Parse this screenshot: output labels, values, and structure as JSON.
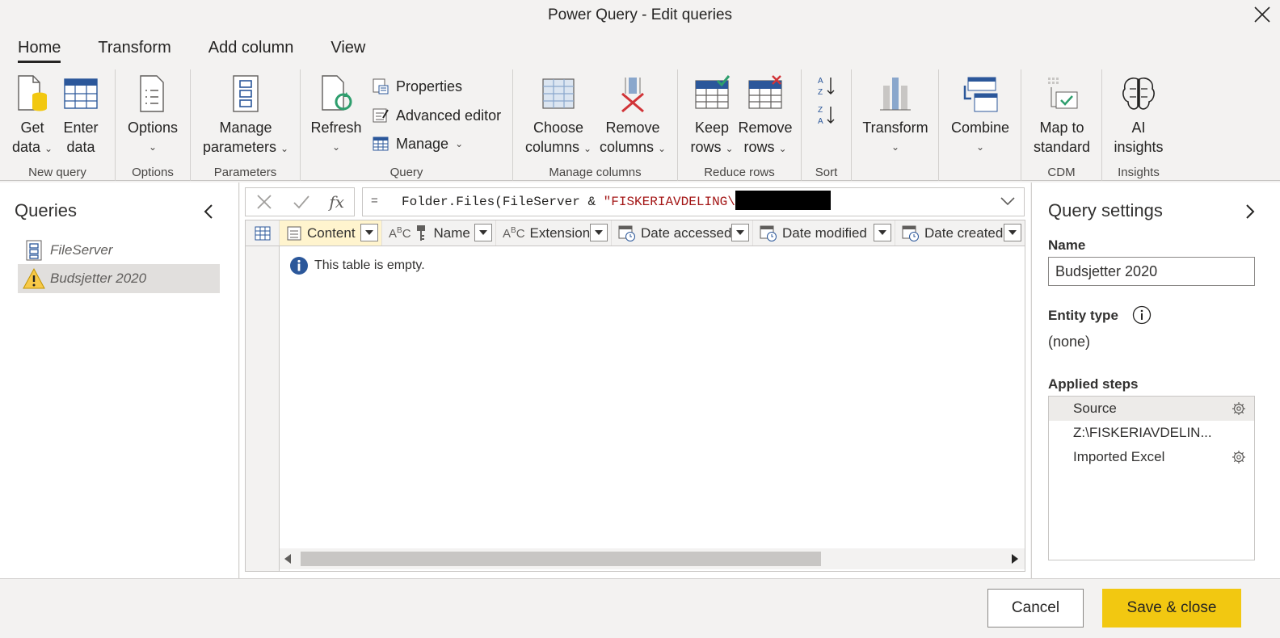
{
  "window": {
    "title": "Power Query - Edit queries"
  },
  "tabs": [
    {
      "label": "Home",
      "active": true
    },
    {
      "label": "Transform"
    },
    {
      "label": "Add column"
    },
    {
      "label": "View"
    }
  ],
  "ribbon": {
    "new_query": {
      "label": "New query",
      "get_data_1": "Get",
      "get_data_2": "data",
      "enter_data_1": "Enter",
      "enter_data_2": "data"
    },
    "options": {
      "label": "Options",
      "options_btn": "Options"
    },
    "parameters": {
      "label": "Parameters",
      "manage_1": "Manage",
      "manage_2": "parameters"
    },
    "query": {
      "label": "Query",
      "refresh": "Refresh",
      "properties": "Properties",
      "advanced_editor": "Advanced editor",
      "manage": "Manage"
    },
    "manage_columns": {
      "label": "Manage columns",
      "choose_1": "Choose",
      "choose_2": "columns",
      "remove_1": "Remove",
      "remove_2": "columns"
    },
    "reduce_rows": {
      "label": "Reduce rows",
      "keep_1": "Keep",
      "keep_2": "rows",
      "remove_1": "Remove",
      "remove_2": "rows"
    },
    "sort": {
      "label": "Sort"
    },
    "transform": {
      "label": "Transform"
    },
    "combine": {
      "label": "Combine"
    },
    "cdm": {
      "label": "CDM",
      "map_1": "Map to",
      "map_2": "standard"
    },
    "insights": {
      "label": "Insights",
      "ai_1": "AI",
      "ai_2": "insights"
    }
  },
  "queries_panel": {
    "title": "Queries",
    "items": [
      {
        "name": "FileServer",
        "icon": "parameter-icon"
      },
      {
        "name": "Budsjetter 2020",
        "icon": "warning-icon",
        "selected": true
      }
    ]
  },
  "formula_bar": {
    "eq": "=",
    "code_prefix": "Folder.Files(FileServer & ",
    "code_string": "\"FISKERIAVDELING\\"
  },
  "grid": {
    "columns": [
      {
        "name": "Content",
        "type_icon": "table-icon"
      },
      {
        "name": "Name",
        "type_icon": "ABC"
      },
      {
        "name": "Extension",
        "type_icon": "ABC"
      },
      {
        "name": "Date accessed",
        "type_icon": "date-icon"
      },
      {
        "name": "Date modified",
        "type_icon": "date-icon"
      },
      {
        "name": "Date created",
        "type_icon": "date-icon"
      }
    ],
    "empty_message": "This table is empty."
  },
  "query_settings": {
    "title": "Query settings",
    "name_label": "Name",
    "name_value": "Budsjetter 2020",
    "entity_type_label": "Entity type",
    "entity_type_value": "(none)",
    "applied_steps_label": "Applied steps",
    "steps": [
      {
        "name": "Source",
        "has_gear": true,
        "active": true
      },
      {
        "name": "Z:\\FISKERIAVDELIN...",
        "has_gear": false
      },
      {
        "name": "Imported Excel",
        "has_gear": true
      }
    ]
  },
  "footer": {
    "cancel": "Cancel",
    "save_close": "Save & close"
  },
  "colors": {
    "accent": "#f2c811",
    "string": "#a31515",
    "brand_blue": "#2b579a"
  }
}
